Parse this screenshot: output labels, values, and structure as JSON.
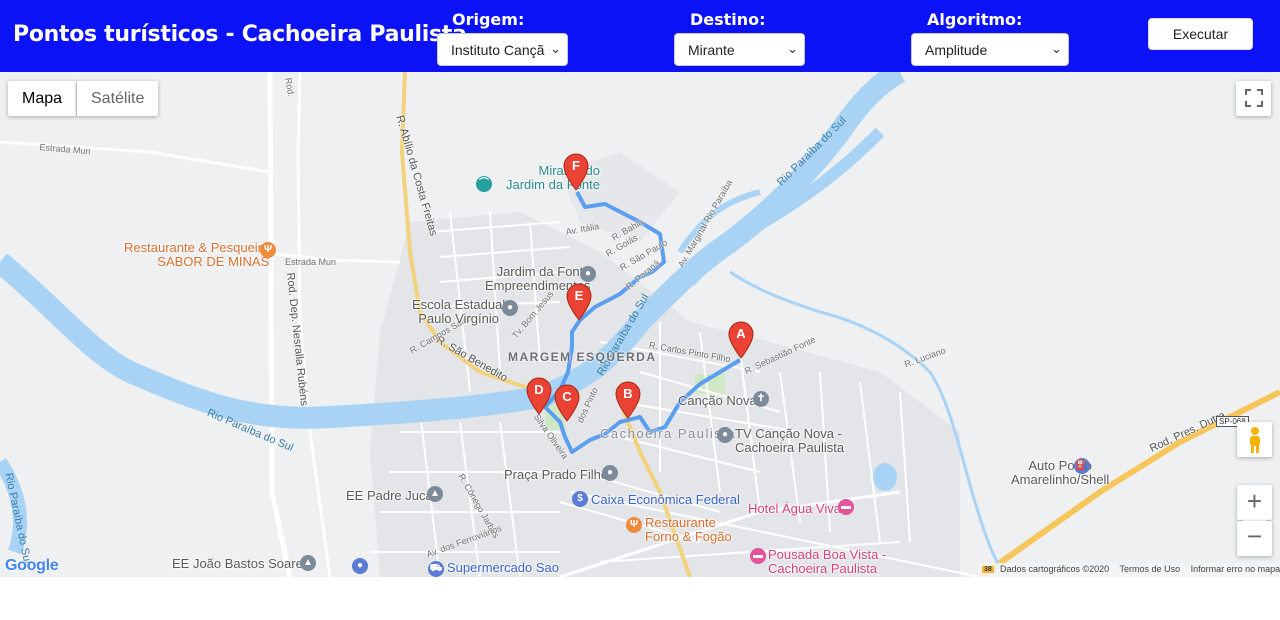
{
  "header": {
    "title": "Pontos turísticos - Cachoeira Paulista",
    "origin": {
      "label": "Origem:",
      "value": "Instituto Cançã"
    },
    "destination": {
      "label": "Destino:",
      "value": "Mirante"
    },
    "algorithm": {
      "label": "Algoritmo:",
      "value": "Amplitude"
    },
    "run_label": "Executar",
    "background_color": "#0b12f5"
  },
  "map_controls": {
    "map_type_map": "Mapa",
    "map_type_satellite": "Satélite",
    "zoom_in": "+",
    "zoom_out": "−",
    "fullscreen_icon": "fullscreen-icon",
    "pegman_icon": "pegman-icon"
  },
  "markers": [
    {
      "letter": "A",
      "color": "#ea4335"
    },
    {
      "letter": "B",
      "color": "#ea4335"
    },
    {
      "letter": "C",
      "color": "#ea4335"
    },
    {
      "letter": "D",
      "color": "#ea4335"
    },
    {
      "letter": "E",
      "color": "#ea4335"
    },
    {
      "letter": "F",
      "color": "#ea4335"
    }
  ],
  "route_color": "#5a9ef0",
  "river_color": "#a9d3f5",
  "places": {
    "mirante": "Mirante do\nJardim da Fonte",
    "restaurante_sabor": "Restaurante & Pesqueiro\nSABOR DE MINAS",
    "jardim_fonte": "Jardim da Fonte\nEmpreendimentos",
    "escola": "Escola Estadual\nPaulo Virgínio",
    "cancao_nova": "Canção Nova",
    "tv_cancao_nova": "TV Canção Nova -\nCachoeira Paulista",
    "praca": "Praça Prado Filho",
    "caixa": "Caixa Econômica Federal",
    "ee_padre_juca": "EE Padre Juca",
    "restaurante_forno": "Restaurante\nForno & Fogão",
    "hotel": "Hotel Água Viva",
    "pousada": "Pousada Boa Vista -\nCachoeira Paulista",
    "ee_joao": "EE João Bastos Soares",
    "supermercado": "Supermercado Sao",
    "auto_posto": "Auto Posto\nAmarelinho/Shell"
  },
  "districts": {
    "margem": "MARGEM\nESQUERDA",
    "cachoeira": "Cachoeira\nPaulista"
  },
  "streets": {
    "abilio": "R. Abílio da Costa Freitas",
    "sao_benedito": "R. São Benedito",
    "dep_nesralla": "Rod. Dep. Nesralla Rubéns",
    "pres_dutra": "Rod. Pres. Dutra",
    "estrada_mun_1": "Estrada Mun",
    "estrada_mun_2": "Estrada Mun",
    "rod_top": "Rod.",
    "av_italia": "Av. Itália",
    "r_bahia": "R. Bahia",
    "r_goias": "R. Goiás",
    "r_sao_paulo": "R. São Paulo",
    "r_parana": "R. Paraná",
    "av_marginal": "Av. Marginal Rio Paraíba",
    "r_carlos_pinto": "R. Carlos Pinto Filho",
    "r_sebastiao": "R. Sebastião Fonte",
    "r_luciano": "R. Luciano",
    "tv_bom_jesus": "Tv. Bom Jesus",
    "r_campos_sales": "R. Campos Sales",
    "r_conego": "R. Cônego Jarbas",
    "av_ferroviarios": "Av. dos Ferroviários",
    "silva": "Silva Oliveira",
    "pinto": "dos Pinto",
    "sp_badge": "SP-068",
    "scale_badge": "38"
  },
  "rivers": {
    "left": "Rio Paraíba do Sul",
    "center": "Rio Paraíba do Sul",
    "upper": "Rio Paraíba do Sul",
    "edge": "Rio Paraíba do Sul"
  },
  "footer": {
    "logo": "Google",
    "attribution": "Dados cartográficos ©2020",
    "terms": "Termos de Uso",
    "report": "Informar erro no mapa"
  }
}
